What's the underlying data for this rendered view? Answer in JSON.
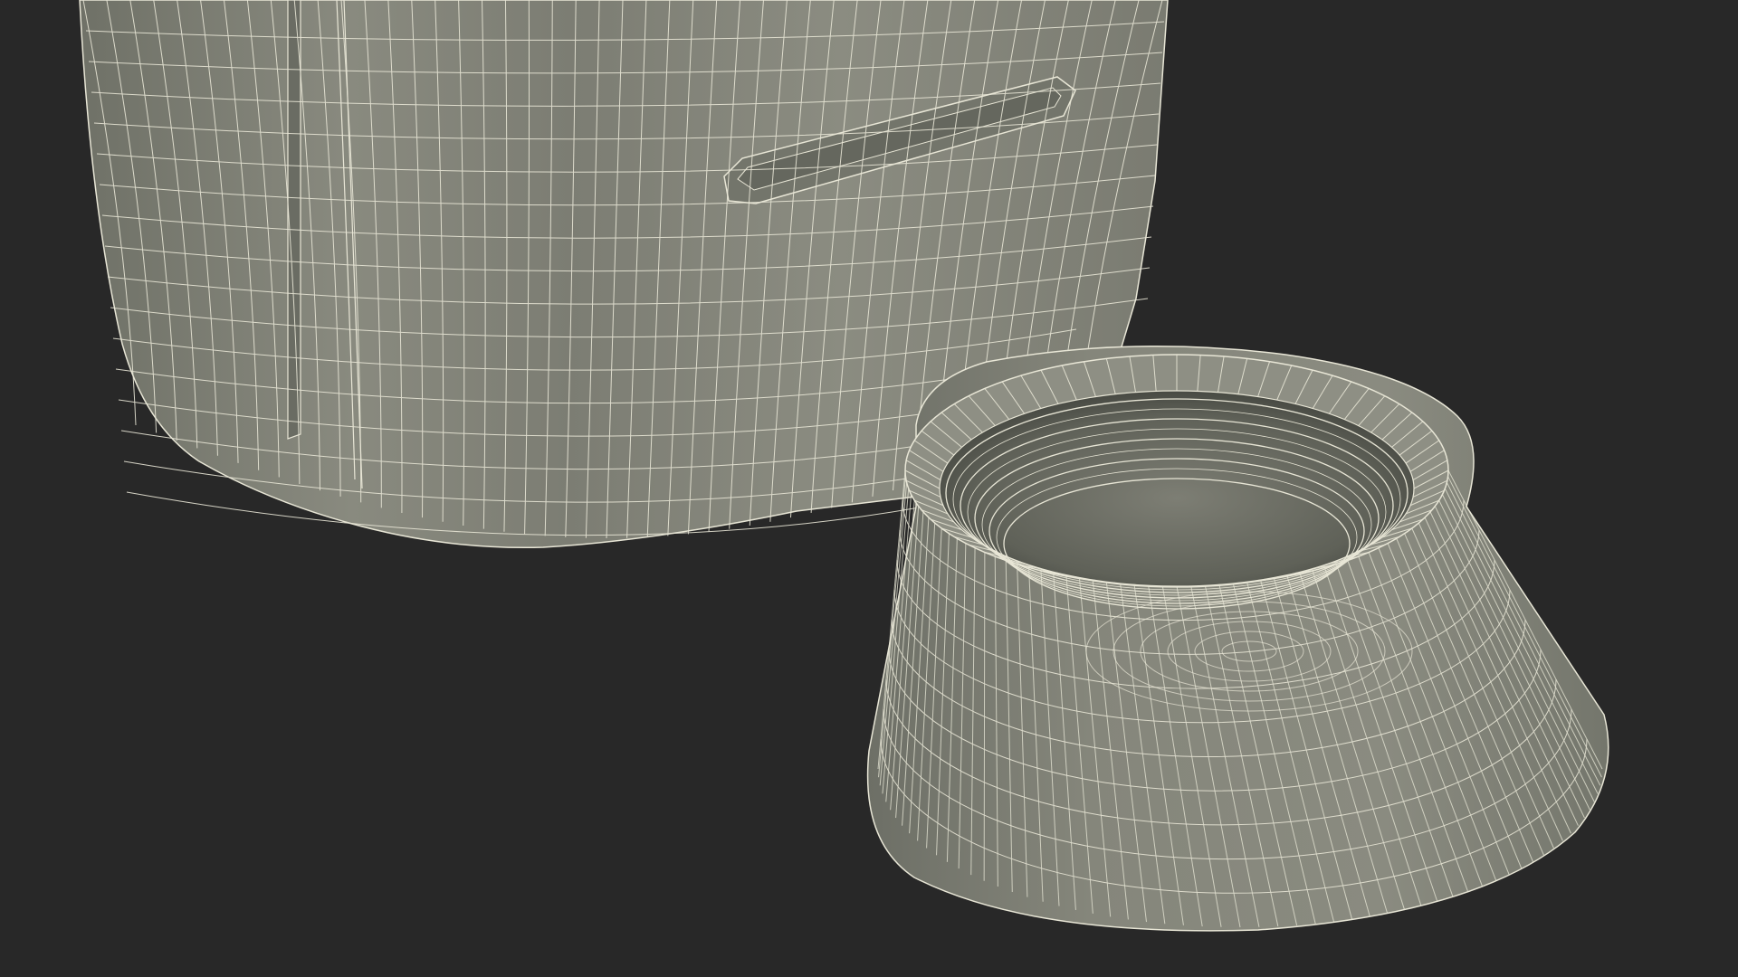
{
  "scene": {
    "background_color": "#282828",
    "surface_color": "#86877c",
    "surface_shadow_color": "#5f6158",
    "surface_dark_color": "#4f514a",
    "wire_color": "#e8e6d6",
    "objects": [
      "bottle-body",
      "bottle-cap"
    ]
  }
}
